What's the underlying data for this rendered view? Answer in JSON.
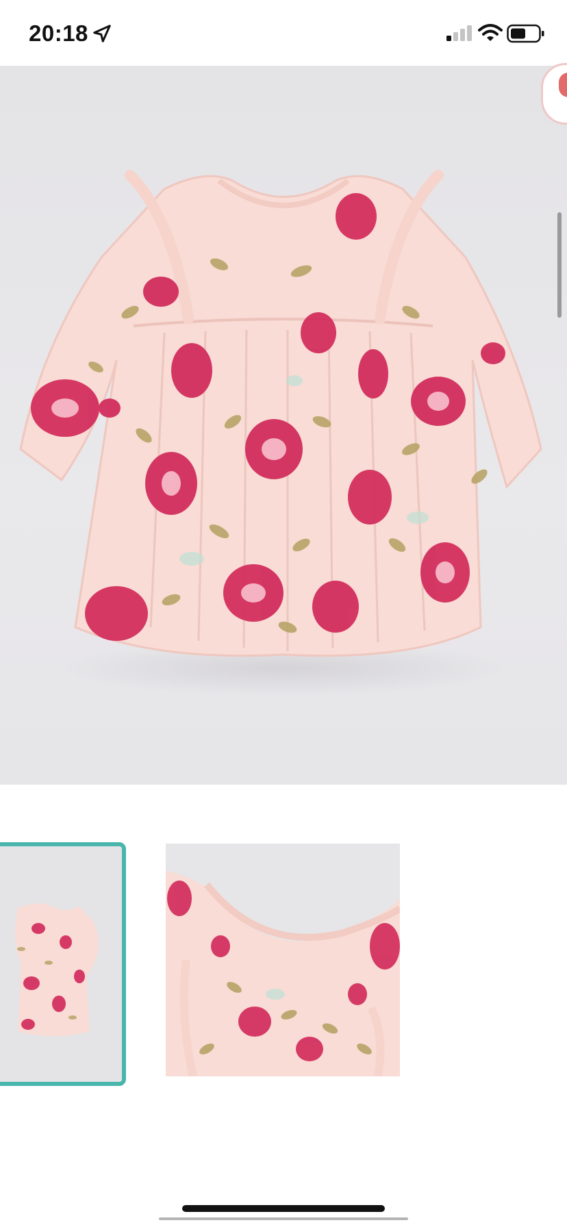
{
  "status_bar": {
    "time": "20:18",
    "icons": [
      "location-arrow-icon",
      "cellular-signal-icon",
      "wifi-icon",
      "battery-icon"
    ]
  },
  "product": {
    "main_image": "floral-dress-image",
    "thumbnails": [
      {
        "name": "thumbnail-full-dress",
        "selected": true
      },
      {
        "name": "thumbnail-collar-detail",
        "selected": false
      }
    ]
  },
  "colors": {
    "accent": "#48b6ac",
    "dress": "#f8dcd5",
    "flower": "#d2295a",
    "leaf": "#b5a060",
    "background": "#e6e5e8"
  }
}
